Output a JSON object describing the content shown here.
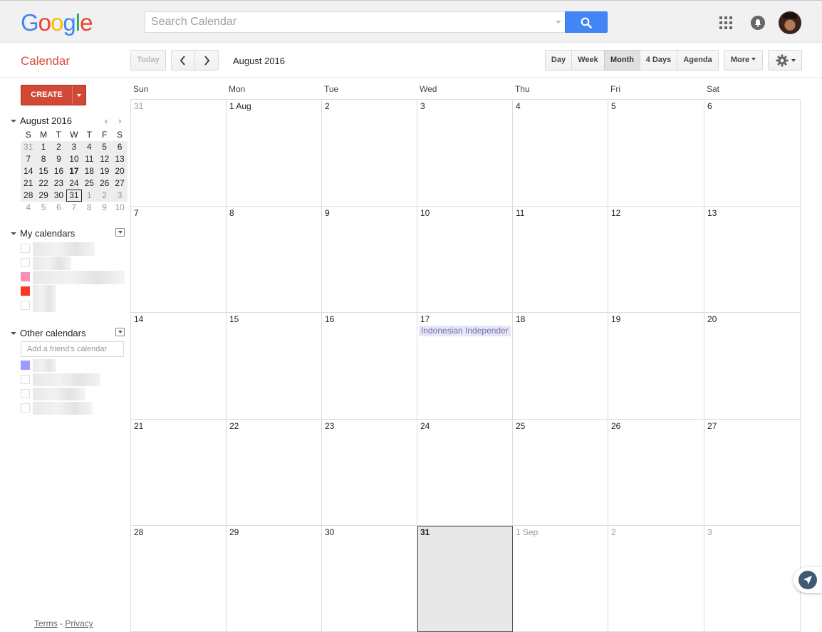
{
  "header": {
    "logo_letters": [
      {
        "char": "G",
        "color": "#4285f4"
      },
      {
        "char": "o",
        "color": "#ea4335"
      },
      {
        "char": "o",
        "color": "#fbbc05"
      },
      {
        "char": "g",
        "color": "#4285f4"
      },
      {
        "char": "l",
        "color": "#34a853"
      },
      {
        "char": "e",
        "color": "#ea4335"
      }
    ],
    "search_placeholder": "Search Calendar",
    "icons": [
      "search-icon",
      "apps-grid-icon",
      "notifications-bell-icon",
      "avatar"
    ]
  },
  "toolbar": {
    "app_title": "Calendar",
    "today_label": "Today",
    "date_range": "August 2016",
    "views": [
      {
        "label": "Day",
        "selected": false
      },
      {
        "label": "Week",
        "selected": false
      },
      {
        "label": "Month",
        "selected": true
      },
      {
        "label": "4 Days",
        "selected": false
      },
      {
        "label": "Agenda",
        "selected": false
      }
    ],
    "more_label": "More"
  },
  "sidebar": {
    "create_label": "CREATE",
    "mini_calendar": {
      "month_label": "August 2016",
      "dow": [
        "S",
        "M",
        "T",
        "W",
        "T",
        "F",
        "S"
      ],
      "weeks": [
        [
          "31",
          "1",
          "2",
          "3",
          "4",
          "5",
          "6"
        ],
        [
          "7",
          "8",
          "9",
          "10",
          "11",
          "12",
          "13"
        ],
        [
          "14",
          "15",
          "16",
          "17",
          "18",
          "19",
          "20"
        ],
        [
          "21",
          "22",
          "23",
          "24",
          "25",
          "26",
          "27"
        ],
        [
          "28",
          "29",
          "30",
          "31",
          "1",
          "2",
          "3"
        ],
        [
          "4",
          "5",
          "6",
          "7",
          "8",
          "9",
          "10"
        ]
      ]
    },
    "my_calendars_label": "My calendars",
    "my_calendars_colors": [
      "#ffffff",
      "#ffffff",
      "#f691b2",
      "#f83a22",
      "#ffffff"
    ],
    "other_calendars_label": "Other calendars",
    "friend_placeholder": "Add a friend's calendar",
    "other_calendars_colors": [
      "#9a9cff",
      "#ffffff",
      "#ffffff",
      "#ffffff"
    ],
    "footer": {
      "terms": "Terms",
      "separator": "-",
      "privacy": "Privacy"
    }
  },
  "month_view": {
    "dow": [
      "Sun",
      "Mon",
      "Tue",
      "Wed",
      "Thu",
      "Fri",
      "Sat"
    ],
    "weeks": [
      [
        "31",
        "1 Aug",
        "2",
        "3",
        "4",
        "5",
        "6"
      ],
      [
        "7",
        "8",
        "9",
        "10",
        "11",
        "12",
        "13"
      ],
      [
        "14",
        "15",
        "16",
        "17",
        "18",
        "19",
        "20"
      ],
      [
        "21",
        "22",
        "23",
        "24",
        "25",
        "26",
        "27"
      ],
      [
        "28",
        "29",
        "30",
        "31",
        "1 Sep",
        "2",
        "3"
      ]
    ],
    "event": {
      "title": "Indonesian Independer",
      "color": "#e6e6f7"
    }
  }
}
